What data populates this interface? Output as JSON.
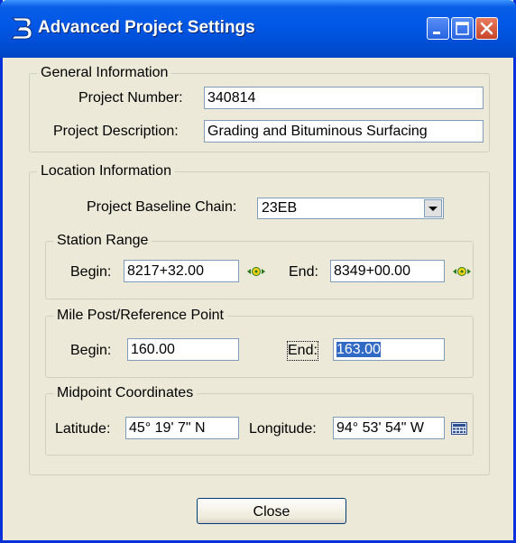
{
  "window": {
    "title": "Advanced Project Settings",
    "icons": {
      "app": "bentley-b-icon",
      "minimize": "minimize-icon",
      "maximize": "maximize-icon",
      "close": "close-icon"
    }
  },
  "general": {
    "legend": "General Information",
    "project_number_label": "Project Number:",
    "project_number": "340814",
    "project_description_label": "Project Description:",
    "project_description": "Grading and Bituminous Surfacing"
  },
  "location": {
    "legend": "Location Information",
    "baseline_label": "Project Baseline Chain:",
    "baseline_value": "23EB"
  },
  "station_range": {
    "legend": "Station Range",
    "begin_label": "Begin:",
    "begin": "8217+32.00",
    "end_label": "End:",
    "end": "8349+00.00"
  },
  "mile_post": {
    "legend": "Mile Post/Reference Point",
    "begin_label": "Begin:",
    "begin": "160.00",
    "end_label": "End:",
    "end": "163.00"
  },
  "midpoint": {
    "legend": "Midpoint Coordinates",
    "latitude_label": "Latitude:",
    "latitude": "45° 19' 7\" N",
    "longitude_label": "Longitude:",
    "longitude": "94° 53' 54\" W"
  },
  "buttons": {
    "close": "Close"
  }
}
